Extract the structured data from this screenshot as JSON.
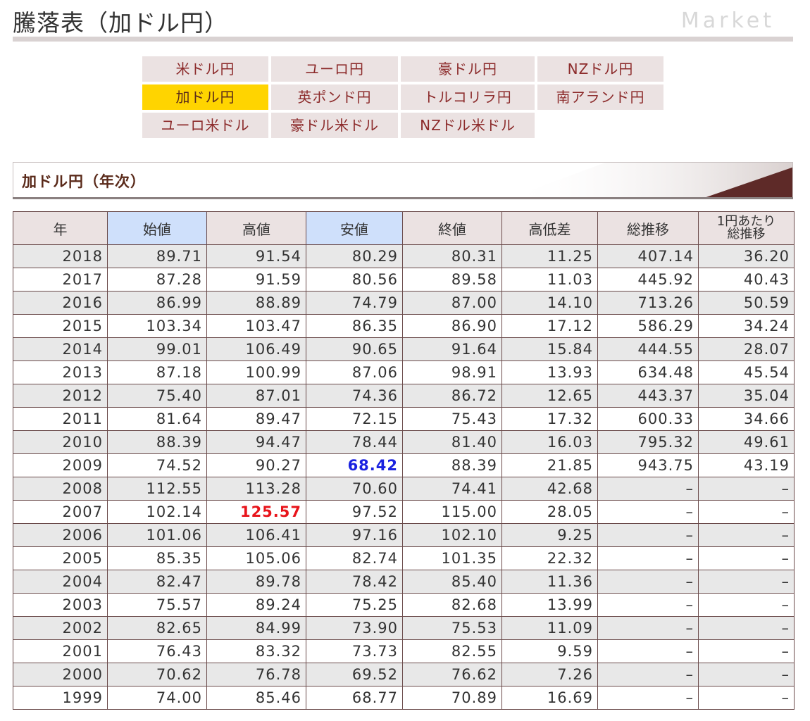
{
  "page": {
    "title": "騰落表（加ドル円）",
    "market_label": "Market"
  },
  "nav": {
    "rows": [
      [
        "米ドル円",
        "ユーロ円",
        "豪ドル円",
        "NZドル円"
      ],
      [
        "加ドル円",
        "英ポンド円",
        "トルコリラ円",
        "南アランド円"
      ],
      [
        "ユーロ米ドル",
        "豪ドル米ドル",
        "NZドル米ドル"
      ]
    ],
    "active": "加ドル円"
  },
  "section": {
    "title": "加ドル円（年次）"
  },
  "colors": {
    "accent_active": "#ffd400",
    "tab_bg": "#ebe2e2",
    "tab_text": "#8c2b2b",
    "header_blue": "#cfe0fb",
    "high_red": "#e8141b",
    "low_blue": "#1a22e0",
    "banner_dark": "#5e2a28"
  },
  "table": {
    "headers": [
      "年",
      "始値",
      "高値",
      "安値",
      "終値",
      "高低差",
      "総推移",
      "1円あたり総推移"
    ],
    "header_last_line1": "1円あたり",
    "header_last_line2": "総推移",
    "rows": [
      [
        "2018",
        "89.71",
        "91.54",
        "80.29",
        "80.31",
        "11.25",
        "407.14",
        "36.20"
      ],
      [
        "2017",
        "87.28",
        "91.59",
        "80.56",
        "89.58",
        "11.03",
        "445.92",
        "40.43"
      ],
      [
        "2016",
        "86.99",
        "88.89",
        "74.79",
        "87.00",
        "14.10",
        "713.26",
        "50.59"
      ],
      [
        "2015",
        "103.34",
        "103.47",
        "86.35",
        "86.90",
        "17.12",
        "586.29",
        "34.24"
      ],
      [
        "2014",
        "99.01",
        "106.49",
        "90.65",
        "91.64",
        "15.84",
        "444.55",
        "28.07"
      ],
      [
        "2013",
        "87.18",
        "100.99",
        "87.06",
        "98.91",
        "13.93",
        "634.48",
        "45.54"
      ],
      [
        "2012",
        "75.40",
        "87.01",
        "74.36",
        "86.72",
        "12.65",
        "443.37",
        "35.04"
      ],
      [
        "2011",
        "81.64",
        "89.47",
        "72.15",
        "75.43",
        "17.32",
        "600.33",
        "34.66"
      ],
      [
        "2010",
        "88.39",
        "94.47",
        "78.44",
        "81.40",
        "16.03",
        "795.32",
        "49.61"
      ],
      [
        "2009",
        "74.52",
        "90.27",
        "68.42",
        "88.39",
        "21.85",
        "943.75",
        "43.19"
      ],
      [
        "2008",
        "112.55",
        "113.28",
        "70.60",
        "74.41",
        "42.68",
        "–",
        "–"
      ],
      [
        "2007",
        "102.14",
        "125.57",
        "97.52",
        "115.00",
        "28.05",
        "–",
        "–"
      ],
      [
        "2006",
        "101.06",
        "106.41",
        "97.16",
        "102.10",
        "9.25",
        "–",
        "–"
      ],
      [
        "2005",
        "85.35",
        "105.06",
        "82.74",
        "101.35",
        "22.32",
        "–",
        "–"
      ],
      [
        "2004",
        "82.47",
        "89.78",
        "78.42",
        "85.40",
        "11.36",
        "–",
        "–"
      ],
      [
        "2003",
        "75.57",
        "89.24",
        "75.25",
        "82.68",
        "13.99",
        "–",
        "–"
      ],
      [
        "2002",
        "82.65",
        "84.99",
        "73.90",
        "75.53",
        "11.09",
        "–",
        "–"
      ],
      [
        "2001",
        "76.43",
        "83.32",
        "73.73",
        "82.55",
        "9.59",
        "–",
        "–"
      ],
      [
        "2000",
        "70.62",
        "76.78",
        "69.52",
        "76.62",
        "7.26",
        "–",
        "–"
      ],
      [
        "1999",
        "74.00",
        "85.46",
        "68.77",
        "70.89",
        "16.69",
        "–",
        "–"
      ]
    ],
    "highest_high": "125.57",
    "lowest_low": "68.42"
  }
}
